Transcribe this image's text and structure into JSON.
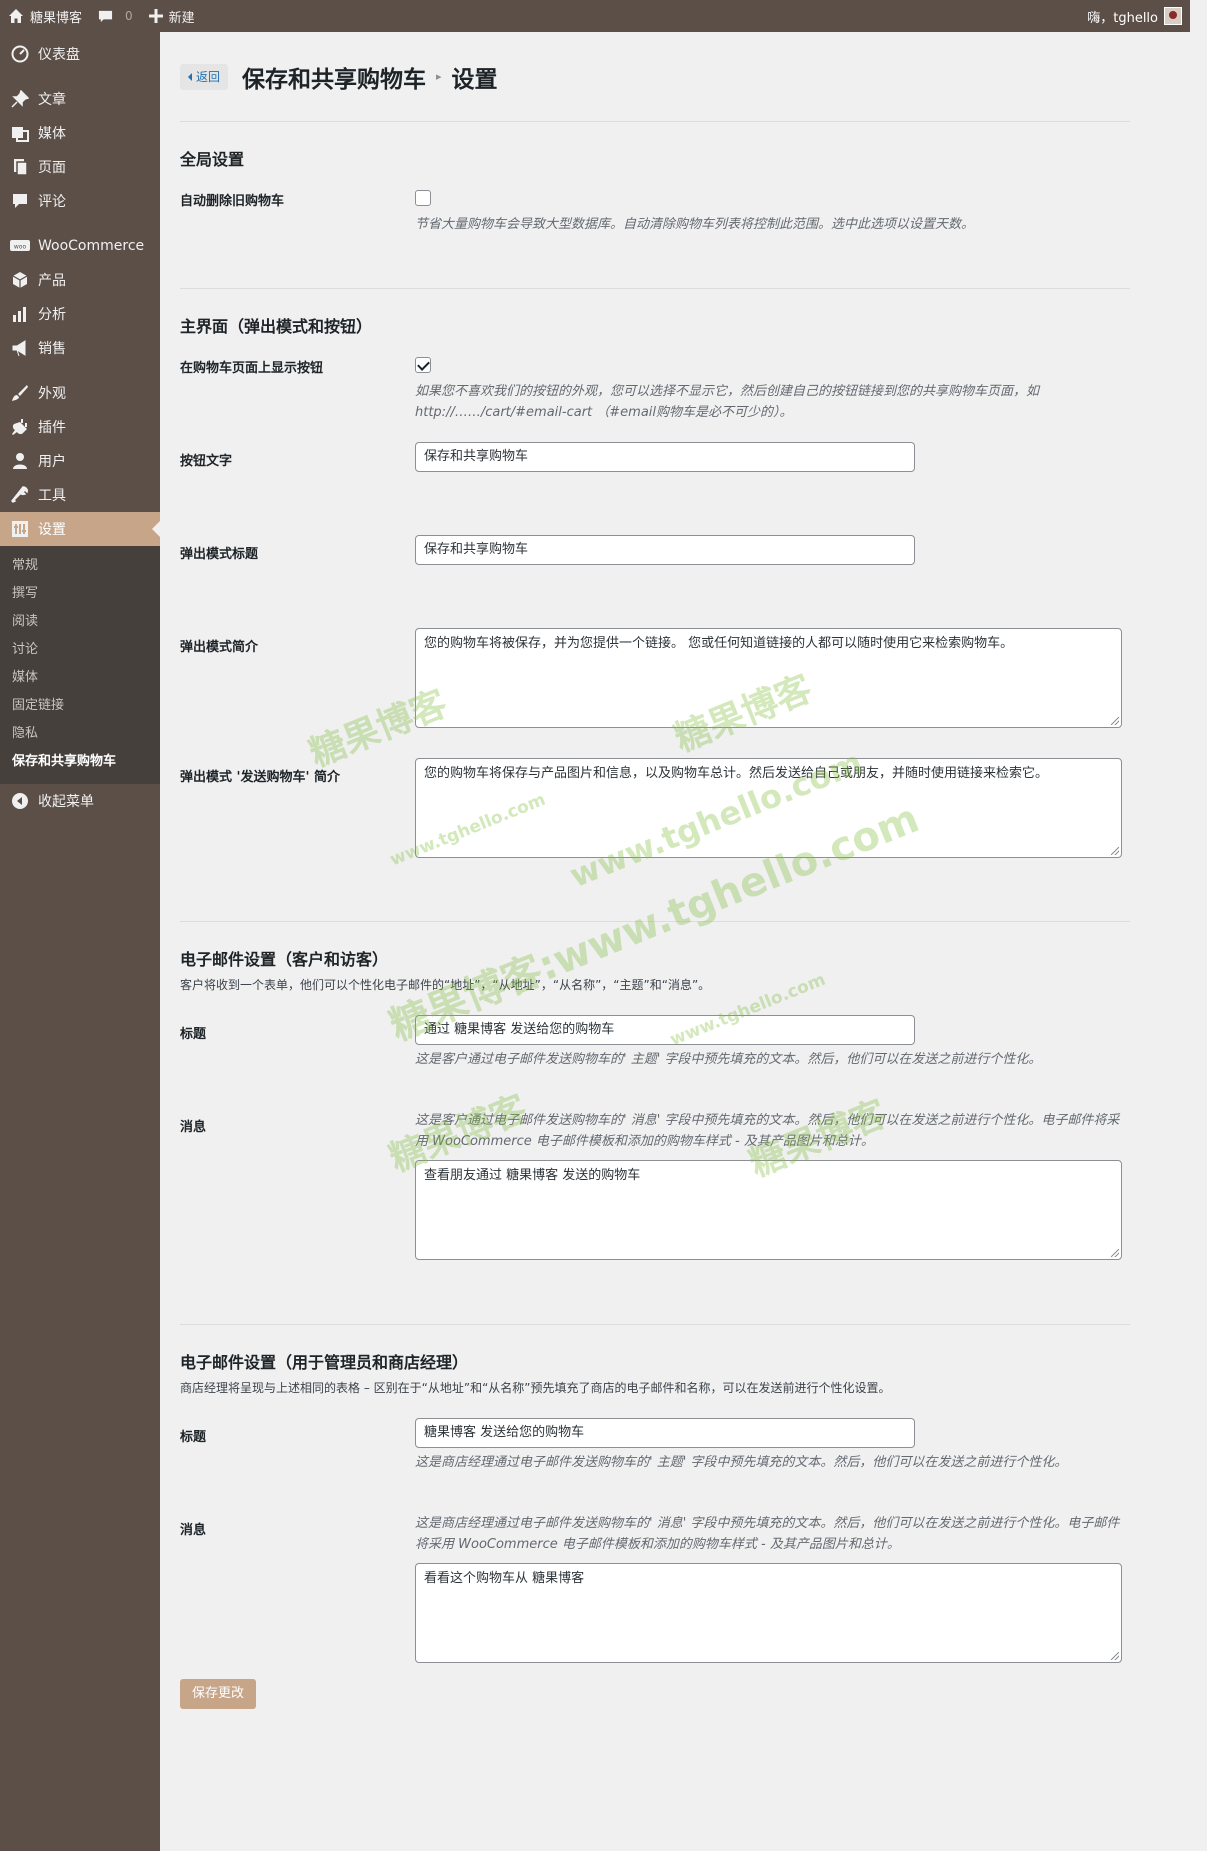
{
  "adminbar": {
    "site_name": "糖果博客",
    "comments_count": "0",
    "new_label": "新建",
    "greeting": "嗨，tghello"
  },
  "sidebar": {
    "items": [
      {
        "label": "仪表盘",
        "icon": "dashboard-icon"
      },
      {
        "label": "文章",
        "icon": "pin-icon"
      },
      {
        "label": "媒体",
        "icon": "media-icon"
      },
      {
        "label": "页面",
        "icon": "page-icon"
      },
      {
        "label": "评论",
        "icon": "comment-icon"
      },
      {
        "label": "WooCommerce",
        "icon": "woocommerce-icon"
      },
      {
        "label": "产品",
        "icon": "product-icon"
      },
      {
        "label": "分析",
        "icon": "analytics-icon"
      },
      {
        "label": "销售",
        "icon": "marketing-icon"
      },
      {
        "label": "外观",
        "icon": "appearance-icon"
      },
      {
        "label": "插件",
        "icon": "plugin-icon"
      },
      {
        "label": "用户",
        "icon": "user-icon"
      },
      {
        "label": "工具",
        "icon": "tools-icon"
      },
      {
        "label": "设置",
        "icon": "settings-icon"
      }
    ],
    "submenu": [
      "常规",
      "撰写",
      "阅读",
      "讨论",
      "媒体",
      "固定链接",
      "隐私",
      "保存和共享购物车"
    ],
    "collapse_label": "收起菜单"
  },
  "header": {
    "back_label": "返回",
    "title": "保存和共享购物车",
    "title_sep": "▸",
    "subtitle": "设置"
  },
  "global": {
    "heading": "全局设置",
    "auto_delete_label": "自动删除旧购物车",
    "auto_delete_checked": false,
    "auto_delete_desc": "节省大量购物车会导致大型数据库。自动清除购物车列表将控制此范围。选中此选项以设置天数。"
  },
  "ui": {
    "heading": "主界面（弹出模式和按钮）",
    "show_button_label": "在购物车页面上显示按钮",
    "show_button_checked": true,
    "show_button_desc": "如果您不喜欢我们的按钮的外观，您可以选择不显示它，然后创建自己的按钮链接到您的共享购物车页面，如 http://……/cart/#email-cart （#email购物车是必不可少的）。",
    "button_text_label": "按钮文字",
    "button_text_value": "保存和共享购物车",
    "popup_title_label": "弹出模式标题",
    "popup_title_value": "保存和共享购物车",
    "popup_intro_label": "弹出模式简介",
    "popup_intro_value": "您的购物车将被保存，并为您提供一个链接。 您或任何知道链接的人都可以随时使用它来检索购物车。",
    "popup_send_label": "弹出模式 '发送购物车' 简介",
    "popup_send_value": "您的购物车将保存与产品图片和信息，以及购物车总计。然后发送给自己或朋友，并随时使用链接来检索它。"
  },
  "email_customer": {
    "heading": "电子邮件设置（客户和访客）",
    "desc": "客户将收到一个表单，他们可以个性化电子邮件的“地址”，“从地址”，“从名称”，“主题”和“消息”。",
    "subject_label": "标题",
    "subject_value": "通过 糖果博客 发送给您的购物车",
    "subject_desc": "这是客户通过电子邮件发送购物车的' 主题' 字段中预先填充的文本。然后，他们可以在发送之前进行个性化。",
    "message_label": "消息",
    "message_desc": "这是客户通过电子邮件发送购物车的' 消息' 字段中预先填充的文本。然后，他们可以在发送之前进行个性化。电子邮件将采用 WooCommerce 电子邮件模板和添加的购物车样式 - 及其产品图片和总计。",
    "message_value": "查看朋友通过 糖果博客 发送的购物车"
  },
  "email_admin": {
    "heading": "电子邮件设置（用于管理员和商店经理）",
    "desc": "商店经理将呈现与上述相同的表格 – 区别在于“从地址”和“从名称”预先填充了商店的电子邮件和名称，可以在发送前进行个性化设置。",
    "subject_label": "标题",
    "subject_value": "糖果博客 发送给您的购物车",
    "subject_desc": "这是商店经理通过电子邮件发送购物车的' 主题' 字段中预先填充的文本。然后，他们可以在发送之前进行个性化。",
    "message_label": "消息",
    "message_desc": "这是商店经理通过电子邮件发送购物车的' 消息' 字段中预先填充的文本。然后，他们可以在发送之前进行个性化。电子邮件将采用 WooCommerce 电子邮件模板和添加的购物车样式 - 及其产品图片和总计。",
    "message_value": "看看这个购物车从 糖果博客"
  },
  "save_label": "保存更改",
  "watermarks": [
    "糖果博客",
    "糖果博客",
    "www.tghello.com",
    "www.tghello.com",
    "糖果博客:www.tghello.com",
    "www.tghello.com",
    "糖果博客",
    "糖果博客"
  ],
  "colors": {
    "adminbar_bg": "#5b4f48",
    "accent": "#c7a589",
    "watermark": "#82be3c"
  }
}
